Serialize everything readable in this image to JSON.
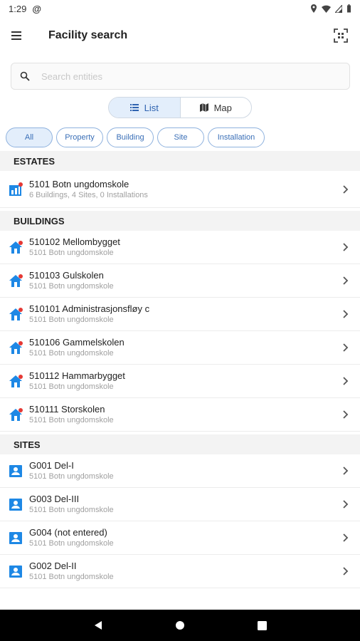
{
  "status_bar": {
    "time": "1:29",
    "at_icon": "@"
  },
  "app_bar": {
    "title": "Facility search"
  },
  "search": {
    "placeholder": "Search entities",
    "value": ""
  },
  "view_toggle": {
    "list_label": "List",
    "map_label": "Map",
    "selected": "List"
  },
  "filters": {
    "chips": [
      "All",
      "Property",
      "Building",
      "Site",
      "Installation"
    ],
    "selected": "All"
  },
  "sections": [
    {
      "title": "ESTATES",
      "icon": "estate-icon",
      "items": [
        {
          "title": "5101 Botn ungdomskole",
          "subtitle": "6 Buildings, 4 Sites, 0 Installations"
        }
      ]
    },
    {
      "title": "BUILDINGS",
      "icon": "building-icon",
      "items": [
        {
          "title": "510102 Mellombygget",
          "subtitle": "5101 Botn ungdomskole"
        },
        {
          "title": "510103 Gulskolen",
          "subtitle": "5101 Botn ungdomskole"
        },
        {
          "title": "510101 Administrasjonsfløy c",
          "subtitle": "5101 Botn ungdomskole"
        },
        {
          "title": "510106 Gammelskolen",
          "subtitle": "5101 Botn ungdomskole"
        },
        {
          "title": "510112 Hammarbygget",
          "subtitle": "5101 Botn ungdomskole"
        },
        {
          "title": "510111 Storskolen",
          "subtitle": "5101 Botn ungdomskole"
        }
      ]
    },
    {
      "title": "SITES",
      "icon": "site-icon",
      "items": [
        {
          "title": "G001 Del-I",
          "subtitle": "5101 Botn ungdomskole"
        },
        {
          "title": "G003 Del-III",
          "subtitle": "5101 Botn ungdomskole"
        },
        {
          "title": "G004 (not entered)",
          "subtitle": "5101 Botn ungdomskole"
        },
        {
          "title": "G002 Del-II",
          "subtitle": "5101 Botn ungdomskole"
        }
      ]
    }
  ],
  "colors": {
    "accent": "#1e88e5",
    "badge": "#e53935",
    "chip_border": "#8fb2de",
    "chip_text": "#3a6fb7"
  }
}
